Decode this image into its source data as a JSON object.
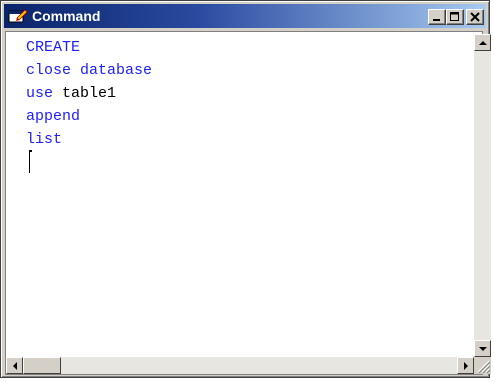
{
  "window": {
    "title": "Command",
    "icon": "command-window-icon",
    "controls": {
      "minimize_icon": "minimize-icon",
      "maximize_icon": "maximize-icon",
      "close_icon": "close-icon"
    }
  },
  "editor": {
    "lines": [
      {
        "keyword": "CREATE",
        "rest": ""
      },
      {
        "keyword": "close database",
        "rest": ""
      },
      {
        "keyword": "use",
        "rest": " table1"
      },
      {
        "keyword": "append",
        "rest": ""
      },
      {
        "keyword": "list",
        "rest": ""
      }
    ]
  },
  "colors": {
    "keyword": "#2020ff",
    "title_start": "#0a246a",
    "title_end": "#a6caf0"
  }
}
